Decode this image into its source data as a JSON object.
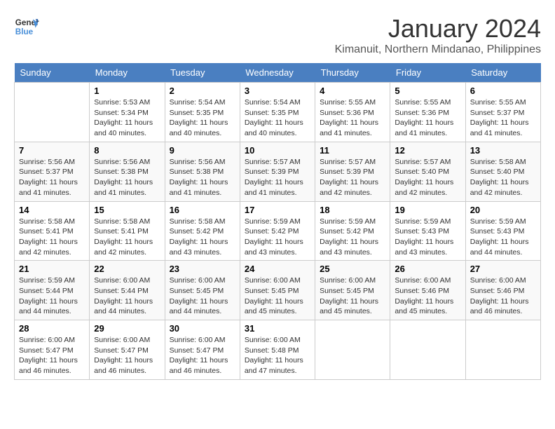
{
  "header": {
    "logo_line1": "General",
    "logo_line2": "Blue",
    "title": "January 2024",
    "subtitle": "Kimanuit, Northern Mindanao, Philippines"
  },
  "days_of_week": [
    "Sunday",
    "Monday",
    "Tuesday",
    "Wednesday",
    "Thursday",
    "Friday",
    "Saturday"
  ],
  "weeks": [
    [
      {
        "day": "",
        "sunrise": "",
        "sunset": "",
        "daylight": ""
      },
      {
        "day": "1",
        "sunrise": "Sunrise: 5:53 AM",
        "sunset": "Sunset: 5:34 PM",
        "daylight": "Daylight: 11 hours and 40 minutes."
      },
      {
        "day": "2",
        "sunrise": "Sunrise: 5:54 AM",
        "sunset": "Sunset: 5:35 PM",
        "daylight": "Daylight: 11 hours and 40 minutes."
      },
      {
        "day": "3",
        "sunrise": "Sunrise: 5:54 AM",
        "sunset": "Sunset: 5:35 PM",
        "daylight": "Daylight: 11 hours and 40 minutes."
      },
      {
        "day": "4",
        "sunrise": "Sunrise: 5:55 AM",
        "sunset": "Sunset: 5:36 PM",
        "daylight": "Daylight: 11 hours and 41 minutes."
      },
      {
        "day": "5",
        "sunrise": "Sunrise: 5:55 AM",
        "sunset": "Sunset: 5:36 PM",
        "daylight": "Daylight: 11 hours and 41 minutes."
      },
      {
        "day": "6",
        "sunrise": "Sunrise: 5:55 AM",
        "sunset": "Sunset: 5:37 PM",
        "daylight": "Daylight: 11 hours and 41 minutes."
      }
    ],
    [
      {
        "day": "7",
        "sunrise": "Sunrise: 5:56 AM",
        "sunset": "Sunset: 5:37 PM",
        "daylight": "Daylight: 11 hours and 41 minutes."
      },
      {
        "day": "8",
        "sunrise": "Sunrise: 5:56 AM",
        "sunset": "Sunset: 5:38 PM",
        "daylight": "Daylight: 11 hours and 41 minutes."
      },
      {
        "day": "9",
        "sunrise": "Sunrise: 5:56 AM",
        "sunset": "Sunset: 5:38 PM",
        "daylight": "Daylight: 11 hours and 41 minutes."
      },
      {
        "day": "10",
        "sunrise": "Sunrise: 5:57 AM",
        "sunset": "Sunset: 5:39 PM",
        "daylight": "Daylight: 11 hours and 41 minutes."
      },
      {
        "day": "11",
        "sunrise": "Sunrise: 5:57 AM",
        "sunset": "Sunset: 5:39 PM",
        "daylight": "Daylight: 11 hours and 42 minutes."
      },
      {
        "day": "12",
        "sunrise": "Sunrise: 5:57 AM",
        "sunset": "Sunset: 5:40 PM",
        "daylight": "Daylight: 11 hours and 42 minutes."
      },
      {
        "day": "13",
        "sunrise": "Sunrise: 5:58 AM",
        "sunset": "Sunset: 5:40 PM",
        "daylight": "Daylight: 11 hours and 42 minutes."
      }
    ],
    [
      {
        "day": "14",
        "sunrise": "Sunrise: 5:58 AM",
        "sunset": "Sunset: 5:41 PM",
        "daylight": "Daylight: 11 hours and 42 minutes."
      },
      {
        "day": "15",
        "sunrise": "Sunrise: 5:58 AM",
        "sunset": "Sunset: 5:41 PM",
        "daylight": "Daylight: 11 hours and 42 minutes."
      },
      {
        "day": "16",
        "sunrise": "Sunrise: 5:58 AM",
        "sunset": "Sunset: 5:42 PM",
        "daylight": "Daylight: 11 hours and 43 minutes."
      },
      {
        "day": "17",
        "sunrise": "Sunrise: 5:59 AM",
        "sunset": "Sunset: 5:42 PM",
        "daylight": "Daylight: 11 hours and 43 minutes."
      },
      {
        "day": "18",
        "sunrise": "Sunrise: 5:59 AM",
        "sunset": "Sunset: 5:42 PM",
        "daylight": "Daylight: 11 hours and 43 minutes."
      },
      {
        "day": "19",
        "sunrise": "Sunrise: 5:59 AM",
        "sunset": "Sunset: 5:43 PM",
        "daylight": "Daylight: 11 hours and 43 minutes."
      },
      {
        "day": "20",
        "sunrise": "Sunrise: 5:59 AM",
        "sunset": "Sunset: 5:43 PM",
        "daylight": "Daylight: 11 hours and 44 minutes."
      }
    ],
    [
      {
        "day": "21",
        "sunrise": "Sunrise: 5:59 AM",
        "sunset": "Sunset: 5:44 PM",
        "daylight": "Daylight: 11 hours and 44 minutes."
      },
      {
        "day": "22",
        "sunrise": "Sunrise: 6:00 AM",
        "sunset": "Sunset: 5:44 PM",
        "daylight": "Daylight: 11 hours and 44 minutes."
      },
      {
        "day": "23",
        "sunrise": "Sunrise: 6:00 AM",
        "sunset": "Sunset: 5:45 PM",
        "daylight": "Daylight: 11 hours and 44 minutes."
      },
      {
        "day": "24",
        "sunrise": "Sunrise: 6:00 AM",
        "sunset": "Sunset: 5:45 PM",
        "daylight": "Daylight: 11 hours and 45 minutes."
      },
      {
        "day": "25",
        "sunrise": "Sunrise: 6:00 AM",
        "sunset": "Sunset: 5:45 PM",
        "daylight": "Daylight: 11 hours and 45 minutes."
      },
      {
        "day": "26",
        "sunrise": "Sunrise: 6:00 AM",
        "sunset": "Sunset: 5:46 PM",
        "daylight": "Daylight: 11 hours and 45 minutes."
      },
      {
        "day": "27",
        "sunrise": "Sunrise: 6:00 AM",
        "sunset": "Sunset: 5:46 PM",
        "daylight": "Daylight: 11 hours and 46 minutes."
      }
    ],
    [
      {
        "day": "28",
        "sunrise": "Sunrise: 6:00 AM",
        "sunset": "Sunset: 5:47 PM",
        "daylight": "Daylight: 11 hours and 46 minutes."
      },
      {
        "day": "29",
        "sunrise": "Sunrise: 6:00 AM",
        "sunset": "Sunset: 5:47 PM",
        "daylight": "Daylight: 11 hours and 46 minutes."
      },
      {
        "day": "30",
        "sunrise": "Sunrise: 6:00 AM",
        "sunset": "Sunset: 5:47 PM",
        "daylight": "Daylight: 11 hours and 46 minutes."
      },
      {
        "day": "31",
        "sunrise": "Sunrise: 6:00 AM",
        "sunset": "Sunset: 5:48 PM",
        "daylight": "Daylight: 11 hours and 47 minutes."
      },
      {
        "day": "",
        "sunrise": "",
        "sunset": "",
        "daylight": ""
      },
      {
        "day": "",
        "sunrise": "",
        "sunset": "",
        "daylight": ""
      },
      {
        "day": "",
        "sunrise": "",
        "sunset": "",
        "daylight": ""
      }
    ]
  ]
}
